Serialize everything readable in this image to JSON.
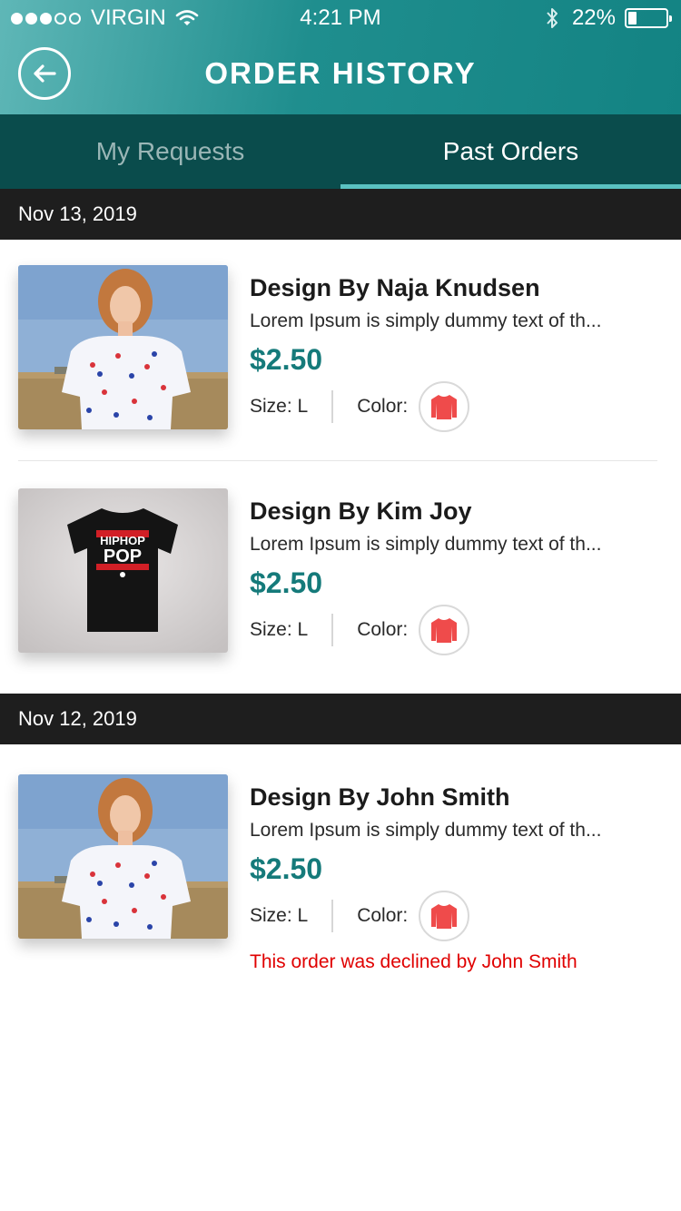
{
  "status_bar": {
    "carrier": "VIRGIN",
    "time": "4:21 PM",
    "battery": "22%",
    "battery_level": 0.22
  },
  "header": {
    "title": "ORDER HISTORY",
    "back_icon": "back-arrow-icon"
  },
  "tabs": [
    {
      "label": "My Requests",
      "active": false
    },
    {
      "label": "Past Orders",
      "active": true
    }
  ],
  "groups": [
    {
      "date": "Nov 13, 2019",
      "orders": [
        {
          "title": "Design By Naja Knudsen",
          "description": "Lorem Ipsum is simply dummy text of th...",
          "price": "$2.50",
          "size_label": "Size: L",
          "color_label": "Color:",
          "color": "#ef4b4b",
          "image": "model-white-tshirt"
        },
        {
          "title": "Design By Kim Joy",
          "description": "Lorem Ipsum is simply dummy text of th...",
          "price": "$2.50",
          "size_label": "Size: L",
          "color_label": "Color:",
          "color": "#ef4b4b",
          "image": "black-tshirt-hiphop-pop",
          "print_line1": "HIPHOP",
          "print_line2": "POP"
        }
      ]
    },
    {
      "date": "Nov 12, 2019",
      "orders": [
        {
          "title": "Design By John Smith",
          "description": "Lorem Ipsum is simply dummy text of th...",
          "price": "$2.50",
          "size_label": "Size: L",
          "color_label": "Color:",
          "color": "#ef4b4b",
          "image": "model-white-tshirt",
          "status": "This order was declined by John Smith"
        }
      ]
    }
  ],
  "colors": {
    "accent": "#157a7a",
    "tab_bar": "#0a4c4c",
    "declined": "#e00000"
  }
}
